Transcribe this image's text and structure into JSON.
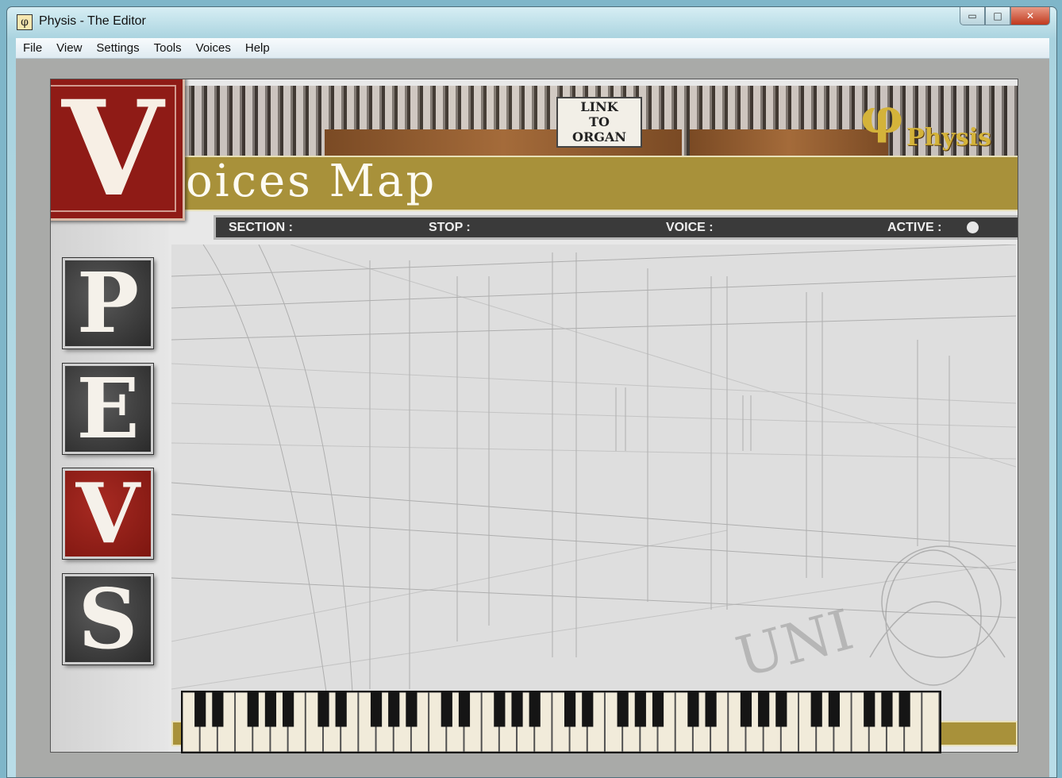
{
  "window": {
    "title": "Physis - The Editor",
    "app_icon": "φ",
    "minimize": "▭",
    "maximize": "□",
    "close": "✕"
  },
  "menu": [
    "File",
    "View",
    "Settings",
    "Tools",
    "Voices",
    "Help"
  ],
  "header": {
    "link_button": [
      "LINK",
      "TO",
      "ORGAN"
    ],
    "logo_symbol": "φ",
    "logo_text": "Physis",
    "title_initial": "V",
    "title_rest": "oices Map"
  },
  "info_bar": {
    "section": "SECTION :",
    "stop": "STOP :",
    "voice": "VOICE :",
    "active": "ACTIVE :"
  },
  "side_buttons": [
    {
      "letter": "P",
      "style": "dark"
    },
    {
      "letter": "E",
      "style": "dark"
    },
    {
      "letter": "V",
      "style": "red"
    },
    {
      "letter": "S",
      "style": "dark"
    }
  ],
  "sketch_lettering": "UNI",
  "keyboard": {
    "white_keys": 43
  }
}
